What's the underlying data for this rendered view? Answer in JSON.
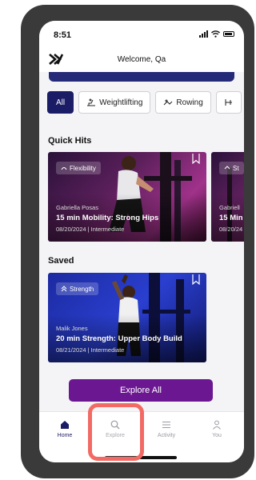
{
  "status": {
    "time": "8:51"
  },
  "header": {
    "title": "Welcome, Qa"
  },
  "filters": [
    {
      "label": "All",
      "icon": "none"
    },
    {
      "label": "Weightlifting",
      "icon": "weightlifting-icon"
    },
    {
      "label": "Rowing",
      "icon": "rowing-icon"
    }
  ],
  "quick_hits": {
    "title": "Quick Hits",
    "cards": [
      {
        "tag": "Flexibility",
        "instructor": "Gabriella Posas",
        "title": "15 min Mobility: Strong Hips",
        "meta": "08/20/2024 | Intermediate"
      },
      {
        "tag": "St",
        "instructor": "Gabriell",
        "title": "15 Min",
        "meta": "08/20/24"
      }
    ]
  },
  "saved": {
    "title": "Saved",
    "cards": [
      {
        "tag": "Strength",
        "instructor": "Malik Jones",
        "title": "20 min Strength: Upper Body Build",
        "meta": "08/21/2024 | Intermediate"
      }
    ]
  },
  "explore_button": "Explore All",
  "tabs": [
    {
      "label": "Home",
      "icon": "home-icon",
      "active": true
    },
    {
      "label": "Explore",
      "icon": "search-icon",
      "active": false
    },
    {
      "label": "Activity",
      "icon": "list-icon",
      "active": false
    },
    {
      "label": "You",
      "icon": "user-icon",
      "active": false
    }
  ],
  "colors": {
    "accent": "#1b1c66",
    "button": "#6b1791",
    "highlight": "#f26a63"
  }
}
